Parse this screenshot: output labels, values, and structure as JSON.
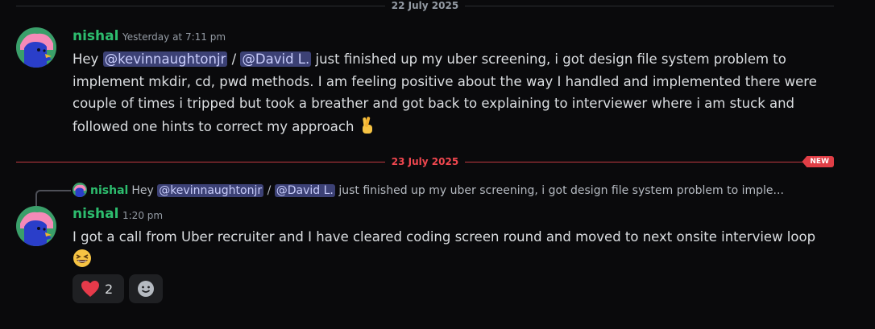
{
  "dividers": [
    {
      "date": "22 July 2025"
    },
    {
      "date": "23 July 2025",
      "badge": "NEW"
    }
  ],
  "messages": [
    {
      "username": "nishal",
      "timestamp": "Yesterday at 7:11 pm",
      "text_1": "Hey ",
      "mention_1": "@kevinnaughtonjr",
      "text_2": " / ",
      "mention_2": "@David L.",
      "text_3": " just finished up my uber screening, i got design file system problem to implement mkdir, cd, pwd methods. I am feeling positive about the way I handled and  implemented there were couple of times i tripped but took a breather and got back to explaining to interviewer where i am stuck and followed one hints to correct my approach ",
      "emoji": "crossed-fingers"
    },
    {
      "reply": {
        "username": "nishal",
        "text_1": "Hey ",
        "mention_1": "@kevinnaughtonjr",
        "text_2": " / ",
        "mention_2": "@David L.",
        "text_3": " just finished up my uber screening, i got design file system problem to imple..."
      },
      "username": "nishal",
      "timestamp": "1:20 pm",
      "text": "I got a call from Uber recruiter and I have cleared coding screen round and moved to next onsite interview loop ",
      "emoji": "grinning-squinting-face",
      "reactions": [
        {
          "icon": "heart-icon",
          "count": "2"
        },
        {
          "icon": "add-reaction-icon"
        }
      ]
    }
  ],
  "colors": {
    "background": "#0a0a0c",
    "username": "#2dbd6e",
    "mention_bg": "#3c4175",
    "new_divider": "#f0474f"
  }
}
